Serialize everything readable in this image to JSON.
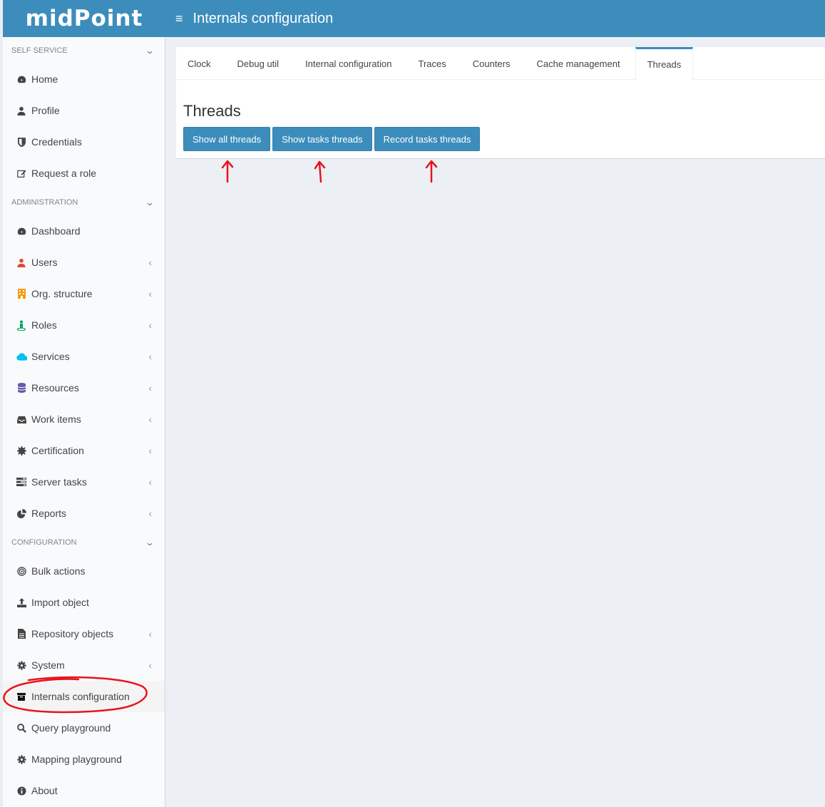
{
  "header": {
    "logo": "midPoint",
    "title": "Internals configuration",
    "menu_icon": "hamburger-icon"
  },
  "sidebar": {
    "sections": [
      {
        "label": "SELF SERVICE",
        "items": [
          {
            "label": "Home",
            "icon": "dashboard-icon"
          },
          {
            "label": "Profile",
            "icon": "user-icon"
          },
          {
            "label": "Credentials",
            "icon": "shield-icon"
          },
          {
            "label": "Request a role",
            "icon": "edit-icon"
          }
        ]
      },
      {
        "label": "ADMINISTRATION",
        "items": [
          {
            "label": "Dashboard",
            "icon": "dashboard-icon"
          },
          {
            "label": "Users",
            "icon": "user-icon",
            "color": "#dd4b39"
          },
          {
            "label": "Org. structure",
            "icon": "building-icon",
            "color": "#f39c12"
          },
          {
            "label": "Roles",
            "icon": "street-view-icon",
            "color": "#00a65a"
          },
          {
            "label": "Services",
            "icon": "cloud-icon",
            "color": "#00c0ef"
          },
          {
            "label": "Resources",
            "icon": "database-icon",
            "color": "#605ca8"
          },
          {
            "label": "Work items",
            "icon": "inbox-icon"
          },
          {
            "label": "Certification",
            "icon": "certificate-icon"
          },
          {
            "label": "Server tasks",
            "icon": "tasks-icon"
          },
          {
            "label": "Reports",
            "icon": "pie-chart-icon"
          }
        ]
      },
      {
        "label": "CONFIGURATION",
        "items": [
          {
            "label": "Bulk actions",
            "icon": "bullseye-icon"
          },
          {
            "label": "Import object",
            "icon": "upload-icon"
          },
          {
            "label": "Repository objects",
            "icon": "file-icon"
          },
          {
            "label": "System",
            "icon": "gear-icon"
          },
          {
            "label": "Internals configuration",
            "icon": "archive-icon"
          },
          {
            "label": "Query playground",
            "icon": "search-icon"
          },
          {
            "label": "Mapping playground",
            "icon": "gear-icon"
          },
          {
            "label": "About",
            "icon": "info-icon"
          }
        ]
      }
    ]
  },
  "tabs": [
    "Clock",
    "Debug util",
    "Internal configuration",
    "Traces",
    "Counters",
    "Cache management",
    "Threads"
  ],
  "active_tab": "Threads",
  "panel": {
    "title": "Threads",
    "buttons": {
      "show_all": "Show all threads",
      "show_tasks": "Show tasks threads",
      "record_tasks": "Record tasks threads"
    }
  },
  "colors": {
    "primary": "#3c8dbc",
    "annotation": "#e8141c"
  }
}
